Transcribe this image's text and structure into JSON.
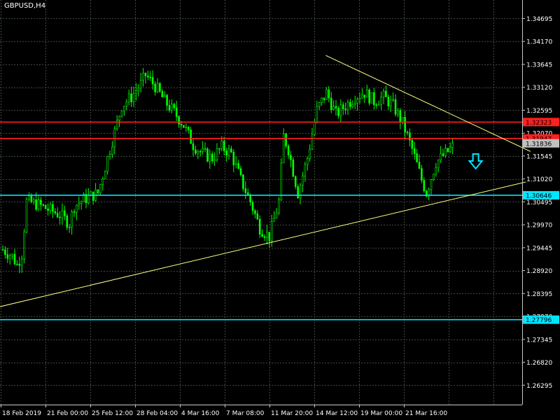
{
  "window": {
    "title": "GBPUSD,H4"
  },
  "colors": {
    "background": "#000000",
    "grid": "#3c4c3c",
    "axis": "#c8c8c8",
    "candle": "#00ff00",
    "trendline": "#ffff80",
    "resistance": "#ff2020",
    "support": "#00e5ff",
    "arrow": "#00e5ff",
    "text": "#ffffff"
  },
  "chart_data": {
    "type": "candlestick",
    "symbol": "GBPUSD",
    "timeframe": "H4",
    "title": "GBPUSD,H4",
    "grid": true,
    "ylim": [
      1.2585,
      1.3512
    ],
    "y_ticks": [
      "1.34695",
      "1.34170",
      "1.33645",
      "1.33120",
      "1.32595",
      "1.32070",
      "1.31545",
      "1.31020",
      "1.30495",
      "1.29970",
      "1.29445",
      "1.28920",
      "1.28395",
      "1.27870",
      "1.27345",
      "1.26820",
      "1.26295"
    ],
    "x_ticks": [
      "18 Feb 2019",
      "21 Feb 00:00",
      "25 Feb 12:00",
      "28 Feb 04:00",
      "4 Mar 16:00",
      "7 Mar 08:00",
      "11 Mar 20:00",
      "14 Mar 12:00",
      "19 Mar 00:00",
      "21 Mar 16:00"
    ],
    "bar_count": 190,
    "close_path": [
      [
        0,
        1.294
      ],
      [
        4,
        1.2925
      ],
      [
        6,
        1.2905
      ],
      [
        8,
        1.293
      ],
      [
        10,
        1.305
      ],
      [
        14,
        1.3045
      ],
      [
        20,
        1.303
      ],
      [
        24,
        1.302
      ],
      [
        28,
        1.3
      ],
      [
        30,
        1.304
      ],
      [
        34,
        1.3055
      ],
      [
        40,
        1.307
      ],
      [
        44,
        1.315
      ],
      [
        48,
        1.323
      ],
      [
        50,
        1.327
      ],
      [
        54,
        1.329
      ],
      [
        58,
        1.332
      ],
      [
        60,
        1.334
      ],
      [
        64,
        1.3315
      ],
      [
        68,
        1.328
      ],
      [
        72,
        1.3255
      ],
      [
        76,
        1.3225
      ],
      [
        80,
        1.318
      ],
      [
        84,
        1.316
      ],
      [
        88,
        1.315
      ],
      [
        92,
        1.3175
      ],
      [
        96,
        1.316
      ],
      [
        100,
        1.31
      ],
      [
        104,
        1.305
      ],
      [
        108,
        1.299
      ],
      [
        112,
        1.297
      ],
      [
        116,
        1.305
      ],
      [
        118,
        1.32
      ],
      [
        120,
        1.317
      ],
      [
        124,
        1.307
      ],
      [
        128,
        1.315
      ],
      [
        132,
        1.326
      ],
      [
        136,
        1.33
      ],
      [
        140,
        1.325
      ],
      [
        144,
        1.327
      ],
      [
        148,
        1.329
      ],
      [
        152,
        1.33
      ],
      [
        156,
        1.328
      ],
      [
        160,
        1.329
      ],
      [
        164,
        1.327
      ],
      [
        168,
        1.323
      ],
      [
        172,
        1.317
      ],
      [
        176,
        1.31
      ],
      [
        178,
        1.307
      ],
      [
        182,
        1.314
      ],
      [
        186,
        1.316
      ],
      [
        189,
        1.3175
      ]
    ],
    "horizontal_lines": [
      {
        "price": 1.32323,
        "label": "1.32323",
        "kind": "resistance"
      },
      {
        "price": 1.31947,
        "label": "1.31947",
        "kind": "resistance"
      },
      {
        "price": 1.31836,
        "label": "1.31836",
        "kind": "bid"
      },
      {
        "price": 1.30646,
        "label": "1.30646",
        "kind": "support"
      },
      {
        "price": 1.27796,
        "label": "1.27796",
        "kind": "support"
      }
    ],
    "trendlines": [
      {
        "bar1": -2,
        "price1": 1.2808,
        "bar2": 220,
        "price2": 1.3095
      },
      {
        "bar1": 136,
        "price1": 1.3385,
        "bar2": 222,
        "price2": 1.3165
      }
    ],
    "signal": {
      "direction": "down",
      "bar": 199,
      "price": 1.314
    }
  }
}
